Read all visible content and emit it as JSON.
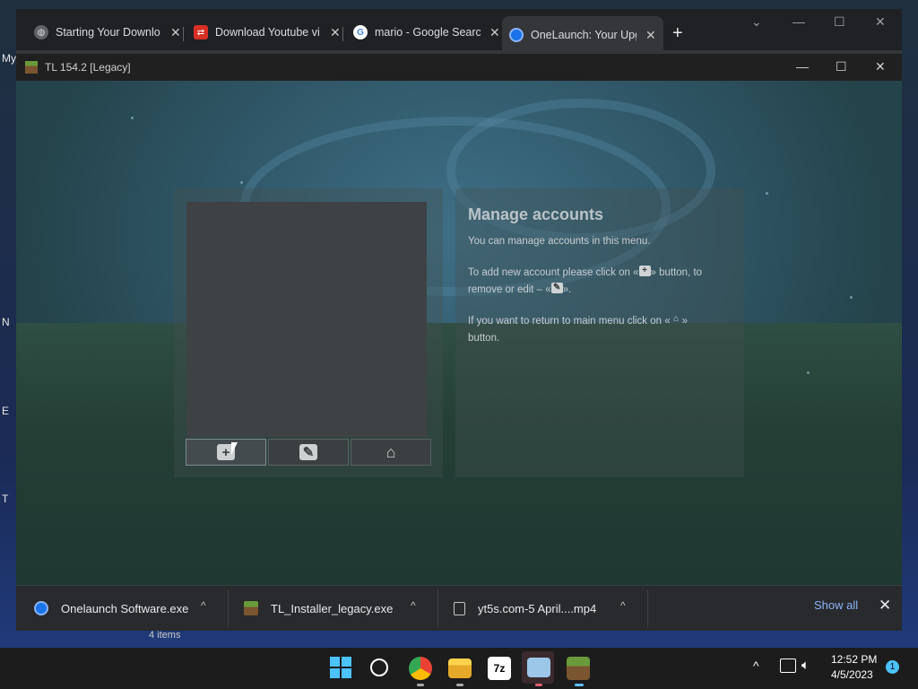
{
  "desktop": {
    "side_labels": [
      "My",
      "N",
      "E",
      "T"
    ]
  },
  "chrome": {
    "tabs": [
      {
        "title": "Starting Your Downlo",
        "icon": "globe-icon"
      },
      {
        "title": "Download Youtube vi",
        "icon": "yt5s-icon"
      },
      {
        "title": "mario - Google Searc",
        "icon": "google-icon"
      },
      {
        "title": "OneLaunch: Your Upg",
        "icon": "onelaunch-icon"
      }
    ],
    "new_tab": "+",
    "window_controls": {
      "minimize": "—",
      "maximize": "☐",
      "close": "✕",
      "tab_search": "⌄"
    }
  },
  "launcher": {
    "title": "TL 154.2 [Legacy]",
    "controls": {
      "minimize": "—",
      "maximize": "☐",
      "close": "✕"
    },
    "accounts": [],
    "buttons": {
      "add": "+",
      "edit": "✎",
      "home": "⌂"
    },
    "help": {
      "title": "Manage accounts",
      "line1": "You can manage accounts in this menu.",
      "add_prefix": "To add new account please click on «",
      "add_suffix": "» button, to",
      "remove_prefix": "remove or edit – «",
      "remove_suffix": "».",
      "home_prefix": "If you want to return to main menu click on «",
      "home_suffix": "»",
      "home_tail": "button."
    }
  },
  "downloads": {
    "items": [
      {
        "name": "Onelaunch Software.exe",
        "icon": "onelaunch-icon"
      },
      {
        "name": "TL_Installer_legacy.exe",
        "icon": "tlauncher-icon"
      },
      {
        "name": "yt5s.com-5 April....mp4",
        "icon": "file-icon"
      }
    ],
    "show_all": "Show all",
    "close": "✕",
    "chevron": "^"
  },
  "explorer_status": "4 items",
  "taskbar": {
    "time": "12:52 PM",
    "date": "4/5/2023",
    "notification_count": "1",
    "tray_chevron": "^"
  }
}
